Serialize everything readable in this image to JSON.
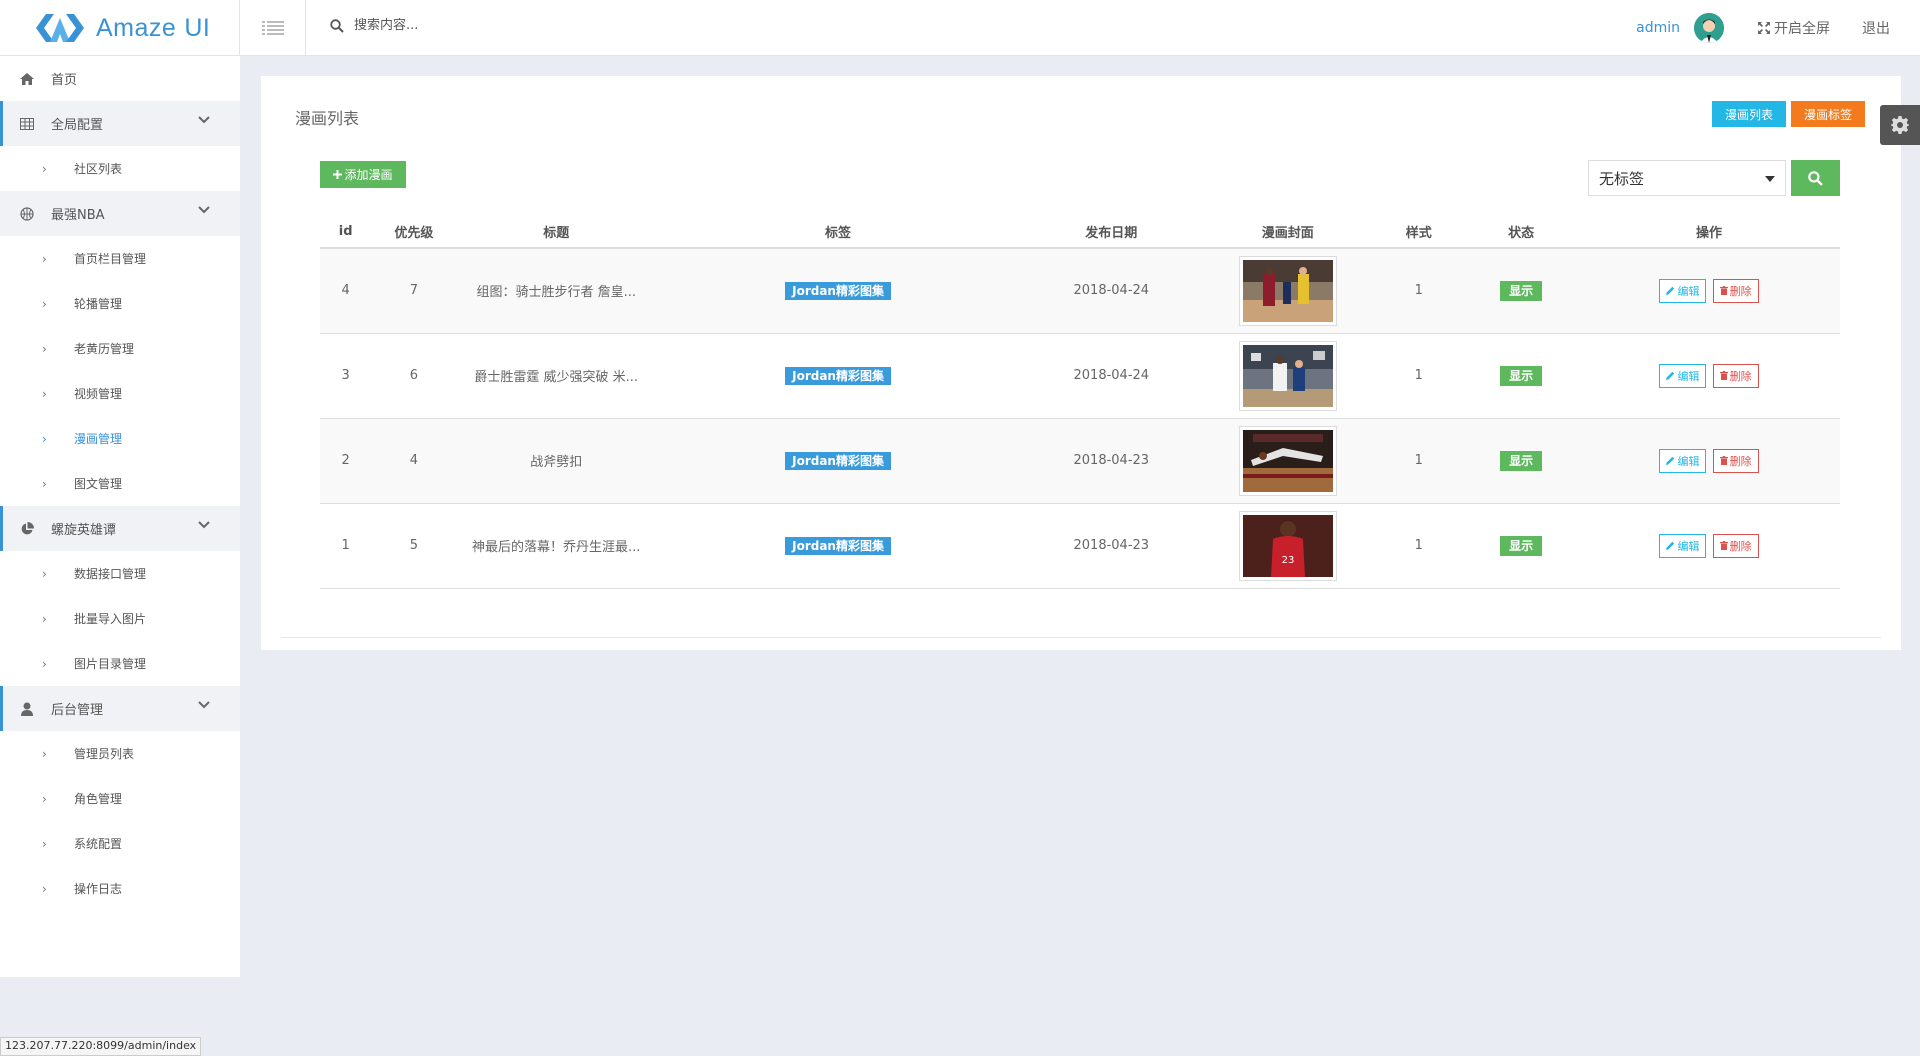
{
  "app": {
    "logo_text": "Amaze",
    "logo_suffix": "UI"
  },
  "header": {
    "search_placeholder": "搜索内容...",
    "username": "admin",
    "fullscreen_label": "开启全屏",
    "logout_label": "退出"
  },
  "sidebar": {
    "home": "首页",
    "groups": [
      {
        "label": "全局配置",
        "icon": "table-icon",
        "items": [
          "社区列表"
        ]
      },
      {
        "label": "最强NBA",
        "icon": "basketball-icon",
        "items": [
          "首页栏目管理",
          "轮播管理",
          "老黄历管理",
          "视频管理",
          "漫画管理",
          "图文管理"
        ]
      },
      {
        "label": "螺旋英雄谭",
        "icon": "pie-chart-icon",
        "items": [
          "数据接口管理",
          "批量导入图片",
          "图片目录管理"
        ]
      },
      {
        "label": "后台管理",
        "icon": "user-icon",
        "items": [
          "管理员列表",
          "角色管理",
          "系统配置",
          "操作日志"
        ]
      }
    ],
    "active_item": "漫画管理"
  },
  "main": {
    "title": "漫画列表",
    "btn_list": "漫画列表",
    "btn_tags": "漫画标签",
    "btn_add": "添加漫画",
    "tag_filter_value": "无标签",
    "columns": [
      "id",
      "优先级",
      "标题",
      "标签",
      "发布日期",
      "漫画封面",
      "样式",
      "状态",
      "操作"
    ],
    "rows": [
      {
        "id": "4",
        "priority": "7",
        "title": "组图：骑士胜步行者 詹皇...",
        "tag": "Jordan精彩图集",
        "date": "2018-04-24",
        "style": "1",
        "status": "显示"
      },
      {
        "id": "3",
        "priority": "6",
        "title": "爵士胜雷霆 威少强突破 米...",
        "tag": "Jordan精彩图集",
        "date": "2018-04-24",
        "style": "1",
        "status": "显示"
      },
      {
        "id": "2",
        "priority": "4",
        "title": "战斧劈扣",
        "tag": "Jordan精彩图集",
        "date": "2018-04-23",
        "style": "1",
        "status": "显示"
      },
      {
        "id": "1",
        "priority": "5",
        "title": "神最后的落幕！乔丹生涯最...",
        "tag": "Jordan精彩图集",
        "date": "2018-04-23",
        "style": "1",
        "status": "显示"
      }
    ],
    "edit_label": "编辑",
    "delete_label": "删除"
  },
  "status_bar": {
    "url": "123.207.77.220:8099/admin/index"
  },
  "colors": {
    "primary": "#3a92d6",
    "green": "#5eb95e",
    "orange": "#f37b1d",
    "cyan": "#23b7e5",
    "red": "#dd514c"
  }
}
